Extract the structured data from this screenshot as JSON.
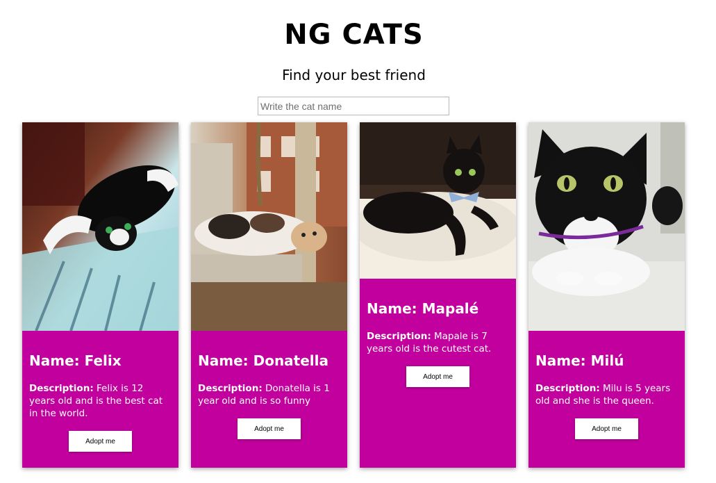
{
  "header": {
    "title": "NG CATS",
    "subtitle": "Find your best friend"
  },
  "search": {
    "placeholder": "Write the cat name",
    "value": ""
  },
  "colors": {
    "card_accent": "#c1009d",
    "button_bg": "#ffffff"
  },
  "cats": [
    {
      "name_label": "Name: Felix",
      "description_label": "Description:",
      "description": "Felix is 12 years old and is the best cat in the world.",
      "button": "Adopt me",
      "photo_icon": "cat-photo-felix"
    },
    {
      "name_label": "Name: Donatella",
      "description_label": "Description:",
      "description": "Donatella is 1 year old and is so funny",
      "button": "Adopt me",
      "photo_icon": "cat-photo-donatella"
    },
    {
      "name_label": "Name: Mapalé",
      "description_label": "Description:",
      "description": "Mapale is 7 years old is the cutest cat.",
      "button": "Adopt me",
      "photo_icon": "cat-photo-mapale"
    },
    {
      "name_label": "Name: Milú",
      "description_label": "Description:",
      "description": "Milu is 5 years old and she is the queen.",
      "button": "Adopt me",
      "photo_icon": "cat-photo-milu"
    }
  ]
}
